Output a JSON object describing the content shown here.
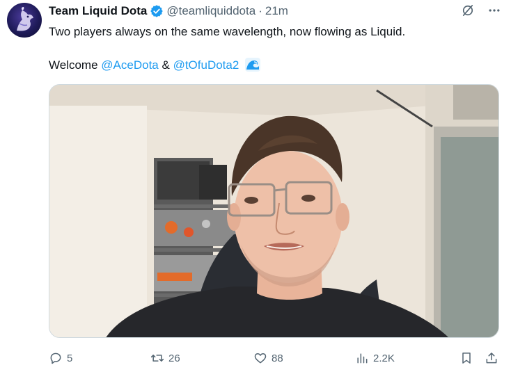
{
  "tweet": {
    "display_name": "Team Liquid Dota",
    "handle": "@teamliquiddota",
    "separator": "·",
    "time": "21m",
    "text_line1": "Two players always on the same wavelength, now flowing as Liquid.",
    "welcome": "Welcome",
    "mention1": "@AceDota",
    "amp": "&",
    "mention2": "@tOfuDota2",
    "emoji": "wave-emoji"
  },
  "header_actions": {
    "grok_icon": "slashed-circle-icon",
    "more_icon": "more-dots-icon"
  },
  "media": {
    "type": "video-frame",
    "description_icon": "person-on-camera"
  },
  "actions": {
    "reply_count": "5",
    "retweet_count": "26",
    "like_count": "88",
    "views_count": "2.2K"
  },
  "colors": {
    "accent": "#1d9bf0",
    "text": "#0f1419",
    "secondary": "#536471"
  }
}
